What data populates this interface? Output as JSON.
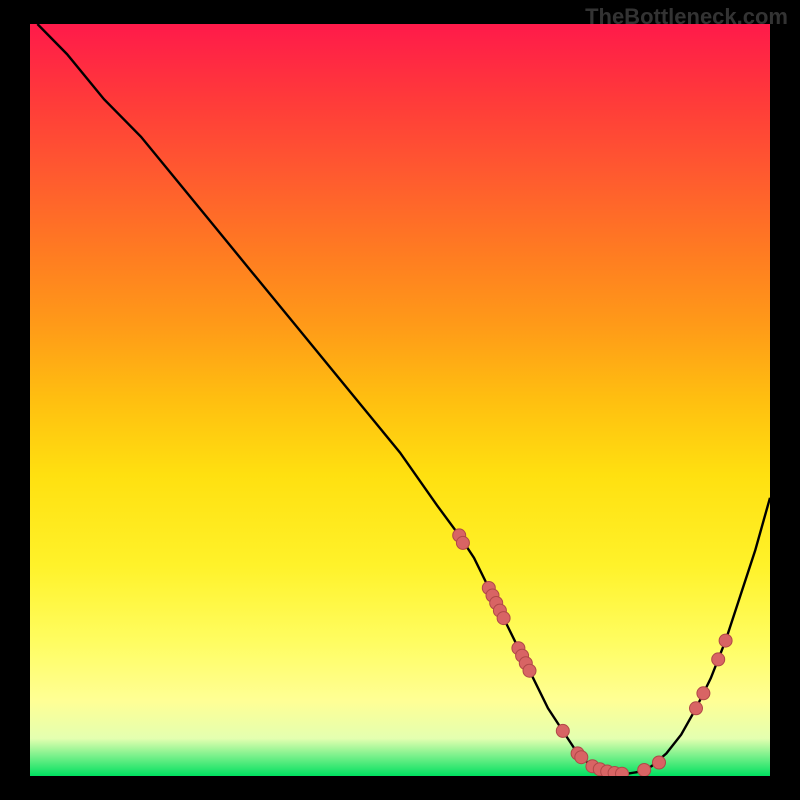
{
  "watermark": "TheBottleneck.com",
  "chart_data": {
    "type": "line",
    "title": "",
    "xlabel": "",
    "ylabel": "",
    "xlim": [
      0,
      100
    ],
    "ylim": [
      0,
      100
    ],
    "series": [
      {
        "name": "curve",
        "x": [
          1,
          5,
          10,
          15,
          20,
          25,
          30,
          35,
          40,
          45,
          50,
          55,
          58,
          60,
          62,
          64,
          66,
          68,
          70,
          72,
          74,
          76,
          78,
          80,
          82,
          84,
          86,
          88,
          90,
          92,
          94,
          96,
          98,
          100
        ],
        "y": [
          100,
          96,
          90,
          85,
          79,
          73,
          67,
          61,
          55,
          49,
          43,
          36,
          32,
          29,
          25,
          21,
          17,
          13,
          9,
          6,
          3,
          1.2,
          0.5,
          0.2,
          0.5,
          1.3,
          3,
          5.5,
          9,
          13,
          18,
          24,
          30,
          37
        ]
      }
    ],
    "points": [
      {
        "x": 58,
        "y": 32
      },
      {
        "x": 58.5,
        "y": 31
      },
      {
        "x": 62,
        "y": 25
      },
      {
        "x": 62.5,
        "y": 24
      },
      {
        "x": 63,
        "y": 23
      },
      {
        "x": 63.5,
        "y": 22
      },
      {
        "x": 64,
        "y": 21
      },
      {
        "x": 66,
        "y": 17
      },
      {
        "x": 66.5,
        "y": 16
      },
      {
        "x": 67,
        "y": 15
      },
      {
        "x": 67.5,
        "y": 14
      },
      {
        "x": 72,
        "y": 6
      },
      {
        "x": 74,
        "y": 3
      },
      {
        "x": 74.5,
        "y": 2.5
      },
      {
        "x": 76,
        "y": 1.3
      },
      {
        "x": 77,
        "y": 0.9
      },
      {
        "x": 78,
        "y": 0.6
      },
      {
        "x": 79,
        "y": 0.4
      },
      {
        "x": 80,
        "y": 0.3
      },
      {
        "x": 83,
        "y": 0.8
      },
      {
        "x": 85,
        "y": 1.8
      },
      {
        "x": 90,
        "y": 9
      },
      {
        "x": 91,
        "y": 11
      },
      {
        "x": 93,
        "y": 15.5
      },
      {
        "x": 94,
        "y": 18
      }
    ],
    "colors": {
      "curve": "#000000",
      "points_fill": "#d86464",
      "points_stroke": "#b04848"
    }
  }
}
